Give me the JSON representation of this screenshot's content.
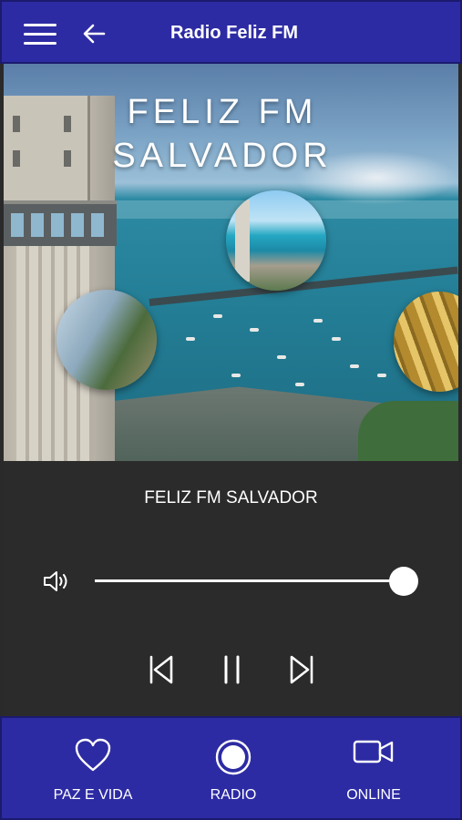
{
  "header": {
    "title": "Radio Feliz FM",
    "menu_icon": "hamburger-menu-icon",
    "back_icon": "arrow-left-icon"
  },
  "hero": {
    "line1": "FELIZ FM",
    "line2": "SALVADOR"
  },
  "player": {
    "station_name": "FELIZ FM SALVADOR",
    "volume": 1.0,
    "controls": [
      "skip-previous-icon",
      "pause-icon",
      "skip-next-icon"
    ]
  },
  "bottom_nav": [
    {
      "label": "PAZ E VIDA",
      "icon": "heart-icon"
    },
    {
      "label": "RADIO",
      "icon": "radio-record-icon"
    },
    {
      "label": "ONLINE",
      "icon": "video-camera-icon"
    }
  ],
  "colors": {
    "bar": "#2d2ba3",
    "player_bg": "#2b2b2b"
  }
}
